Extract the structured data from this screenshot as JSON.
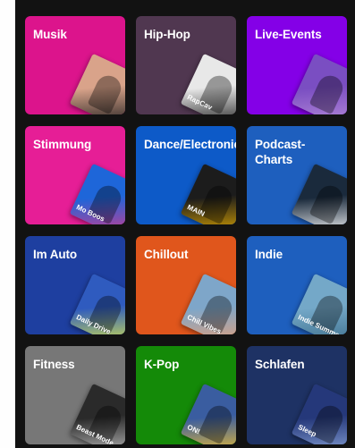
{
  "categories": [
    {
      "label": "Musik",
      "bg": "#dc148c",
      "art": "#d9a38a",
      "art_text": "",
      "art_accent": "#1e1e1e"
    },
    {
      "label": "Hip-Hop",
      "bg": "#503750",
      "art": "#e8e8e8",
      "art_text": "RapCav",
      "art_accent": "#222222"
    },
    {
      "label": "Live-Events",
      "bg": "#8400e7",
      "art": "#7a4ec2",
      "art_text": "",
      "art_accent": "#b58ad8"
    },
    {
      "label": "Stimmung",
      "bg": "#e61e96",
      "art": "#1e66d9",
      "art_text": "Mo Boos",
      "art_accent": "#cf3a8f"
    },
    {
      "label": "Dance/Electronic",
      "bg": "#0d5ac8",
      "art": "#1c1c1c",
      "art_text": "MAIN",
      "art_accent": "#e0a800"
    },
    {
      "label": "Podcast-Charts",
      "bg": "#1e5fbe",
      "art": "#1a2a3c",
      "art_text": "",
      "art_accent": "#ffffff"
    },
    {
      "label": "Im Auto",
      "bg": "#1e3fa0",
      "art": "#2f5bbf",
      "art_text": "Daily Drive",
      "art_accent": "#d6e64a"
    },
    {
      "label": "Chillout",
      "bg": "#e0561c",
      "art": "#7ea6c9",
      "art_text": "Chill Vibes",
      "art_accent": "#e4a07a"
    },
    {
      "label": "Indie",
      "bg": "#1e5fbe",
      "art": "#74a8c8",
      "art_text": "Indie Summer",
      "art_accent": "#3d6f8c"
    },
    {
      "label": "Fitness",
      "bg": "#777777",
      "art": "#2a2a2a",
      "art_text": "Beast Mode",
      "art_accent": "#bdbdbd"
    },
    {
      "label": "K-Pop",
      "bg": "#148a08",
      "art": "#3a5da0",
      "art_text": "ON!",
      "art_accent": "#f2c12e"
    },
    {
      "label": "Schlafen",
      "bg": "#1e3264",
      "art": "#25387a",
      "art_text": "Sleep",
      "art_accent": "#8aa4d8"
    }
  ]
}
